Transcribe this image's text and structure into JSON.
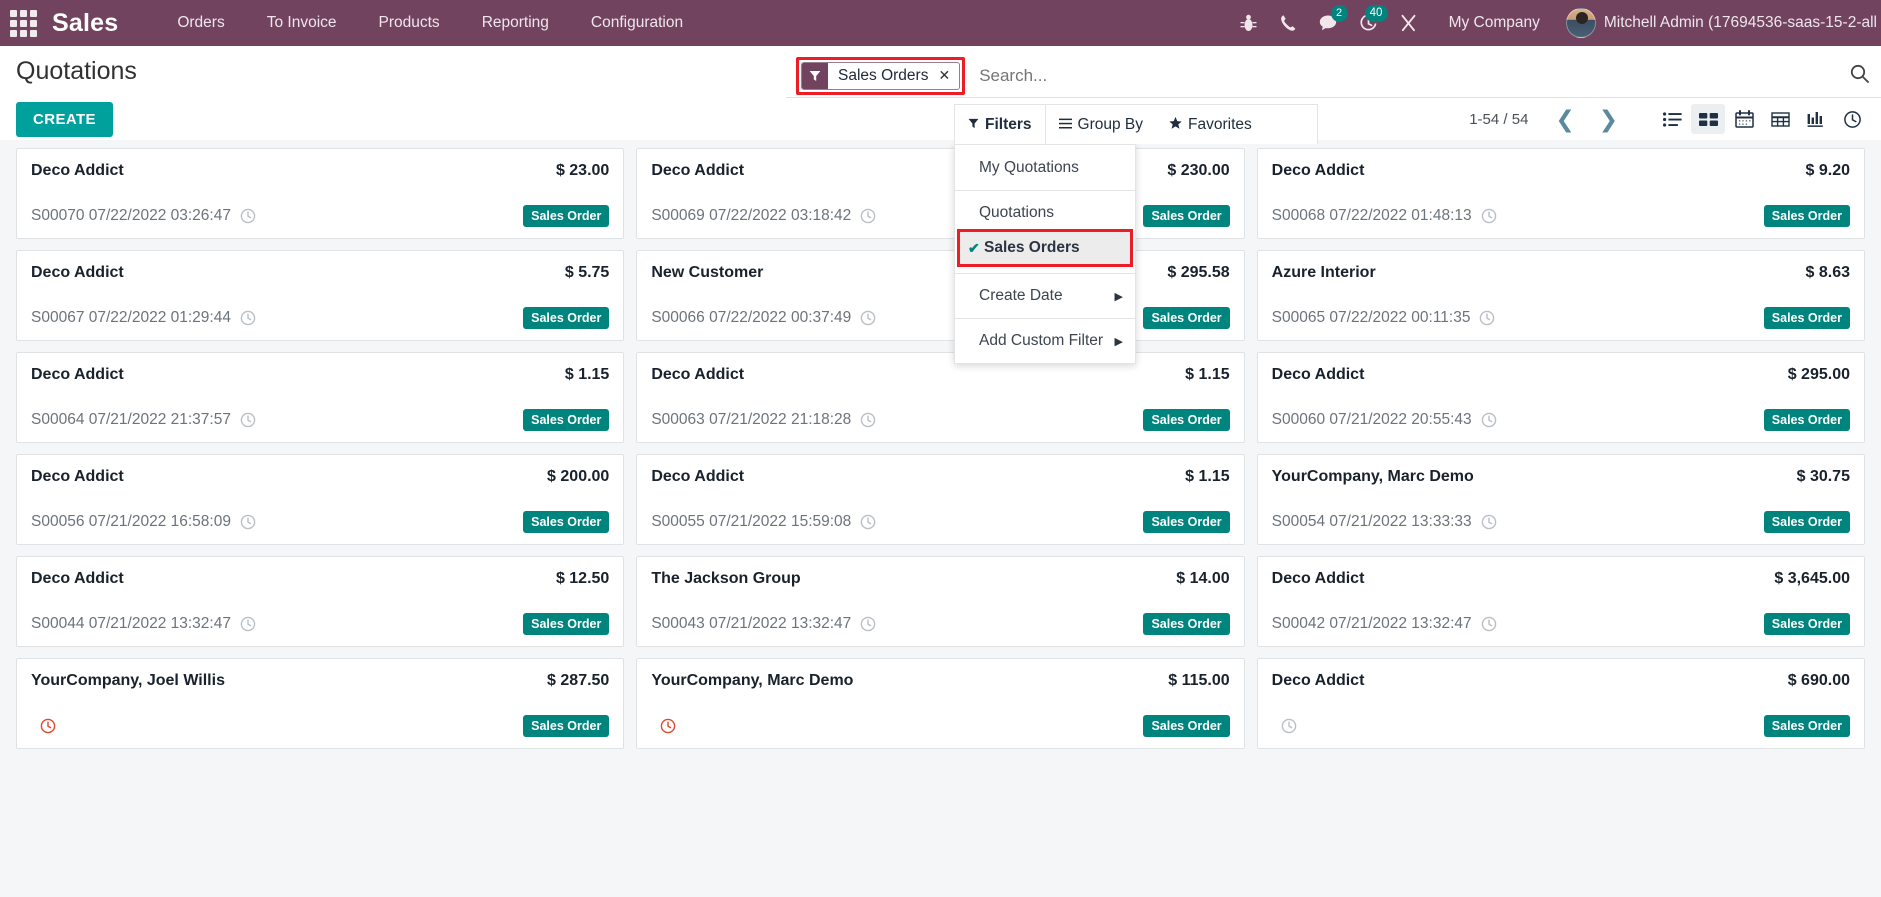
{
  "navbar": {
    "apps_icon": "apps-grid-icon",
    "brand": "Sales",
    "menus": [
      "Orders",
      "To Invoice",
      "Products",
      "Reporting",
      "Configuration"
    ],
    "icons": [
      {
        "name": "bug-icon",
        "badge": null
      },
      {
        "name": "phone-icon",
        "badge": null
      },
      {
        "name": "messages-icon",
        "badge": "2"
      },
      {
        "name": "activities-clock-icon",
        "badge": "40"
      },
      {
        "name": "tools-icon",
        "badge": null
      }
    ],
    "company": "My Company",
    "user": "Mitchell Admin (17694536-saas-15-2-all",
    "bg_color": "#71435f"
  },
  "control_panel": {
    "title": "Quotations",
    "create_label": "CREATE",
    "pager": "1-54 / 54",
    "prev_label": "❮",
    "next_label": "❯",
    "search": {
      "placeholder": "Search...",
      "facet_label": "Sales Orders",
      "facet_remove": "✕",
      "facet_icon": "filter-funnel-icon"
    },
    "views": [
      {
        "name": "list-view",
        "label": "List",
        "active": false
      },
      {
        "name": "kanban-view",
        "label": "Kanban",
        "active": true
      },
      {
        "name": "calendar-view",
        "label": "Calendar",
        "active": false
      },
      {
        "name": "pivot-view",
        "label": "Pivot",
        "active": false
      },
      {
        "name": "graph-view",
        "label": "Graph",
        "active": false
      },
      {
        "name": "activity-view",
        "label": "Activity",
        "active": false
      }
    ]
  },
  "filter_dropdown": {
    "tabs": [
      {
        "label": "Filters",
        "icon": "filter-funnel-icon",
        "active": true
      },
      {
        "label": "Group By",
        "icon": "list-lines-icon",
        "active": false
      },
      {
        "label": "Favorites",
        "icon": "star-icon",
        "active": false
      }
    ],
    "groups": [
      {
        "items": [
          {
            "label": "My Quotations",
            "selected": false,
            "submenu": false
          }
        ]
      },
      {
        "items": [
          {
            "label": "Quotations",
            "selected": false,
            "submenu": false
          },
          {
            "label": "Sales Orders",
            "selected": true,
            "submenu": false,
            "highlighted": true
          }
        ]
      },
      {
        "items": [
          {
            "label": "Create Date",
            "selected": false,
            "submenu": true
          }
        ]
      },
      {
        "items": [
          {
            "label": "Add Custom Filter",
            "selected": false,
            "submenu": true
          }
        ]
      }
    ],
    "tick": "✔",
    "caret": "▶"
  },
  "kanban": {
    "status_tag": "Sales Order",
    "cards": [
      {
        "name": "Deco Addict",
        "amount": "$ 23.00",
        "ref": "S00070 07/22/2022 03:26:47",
        "tag": "Sales Order",
        "activity": "normal"
      },
      {
        "name": "Deco Addict",
        "amount": "$ 230.00",
        "ref": "S00069 07/22/2022 03:18:42",
        "tag": "Sales Order",
        "activity": "normal"
      },
      {
        "name": "Deco Addict",
        "amount": "$ 9.20",
        "ref": "S00068 07/22/2022 01:48:13",
        "tag": "Sales Order",
        "activity": "normal"
      },
      {
        "name": "Deco Addict",
        "amount": "$ 5.75",
        "ref": "S00067 07/22/2022 01:29:44",
        "tag": "Sales Order",
        "activity": "normal"
      },
      {
        "name": "New Customer",
        "amount": "$ 295.58",
        "ref": "S00066 07/22/2022 00:37:49",
        "tag": "Sales Order",
        "activity": "normal"
      },
      {
        "name": "Azure Interior",
        "amount": "$ 8.63",
        "ref": "S00065 07/22/2022 00:11:35",
        "tag": "Sales Order",
        "activity": "normal"
      },
      {
        "name": "Deco Addict",
        "amount": "$ 1.15",
        "ref": "S00064 07/21/2022 21:37:57",
        "tag": "Sales Order",
        "activity": "normal"
      },
      {
        "name": "Deco Addict",
        "amount": "$ 1.15",
        "ref": "S00063 07/21/2022 21:18:28",
        "tag": "Sales Order",
        "activity": "normal"
      },
      {
        "name": "Deco Addict",
        "amount": "$ 295.00",
        "ref": "S00060 07/21/2022 20:55:43",
        "tag": "Sales Order",
        "activity": "normal"
      },
      {
        "name": "Deco Addict",
        "amount": "$ 200.00",
        "ref": "S00056 07/21/2022 16:58:09",
        "tag": "Sales Order",
        "activity": "normal"
      },
      {
        "name": "Deco Addict",
        "amount": "$ 1.15",
        "ref": "S00055 07/21/2022 15:59:08",
        "tag": "Sales Order",
        "activity": "normal"
      },
      {
        "name": "YourCompany, Marc Demo",
        "amount": "$ 30.75",
        "ref": "S00054 07/21/2022 13:33:33",
        "tag": "Sales Order",
        "activity": "normal"
      },
      {
        "name": "Deco Addict",
        "amount": "$ 12.50",
        "ref": "S00044 07/21/2022 13:32:47",
        "tag": "Sales Order",
        "activity": "normal"
      },
      {
        "name": "The Jackson Group",
        "amount": "$ 14.00",
        "ref": "S00043 07/21/2022 13:32:47",
        "tag": "Sales Order",
        "activity": "normal"
      },
      {
        "name": "Deco Addict",
        "amount": "$ 3,645.00",
        "ref": "S00042 07/21/2022 13:32:47",
        "tag": "Sales Order",
        "activity": "normal"
      },
      {
        "name": "YourCompany, Joel Willis",
        "amount": "$ 287.50",
        "ref": "",
        "tag": "Sales Order",
        "activity": "late"
      },
      {
        "name": "YourCompany, Marc Demo",
        "amount": "$ 115.00",
        "ref": "",
        "tag": "Sales Order",
        "activity": "late"
      },
      {
        "name": "Deco Addict",
        "amount": "$ 690.00",
        "ref": "",
        "tag": "Sales Order",
        "activity": "normal"
      }
    ]
  },
  "colors": {
    "brand_purple": "#71435f",
    "teal": "#00847e",
    "create_teal": "#00a09d",
    "highlight_red": "#ee1c25",
    "kanban_bg": "#f5f6f7"
  }
}
